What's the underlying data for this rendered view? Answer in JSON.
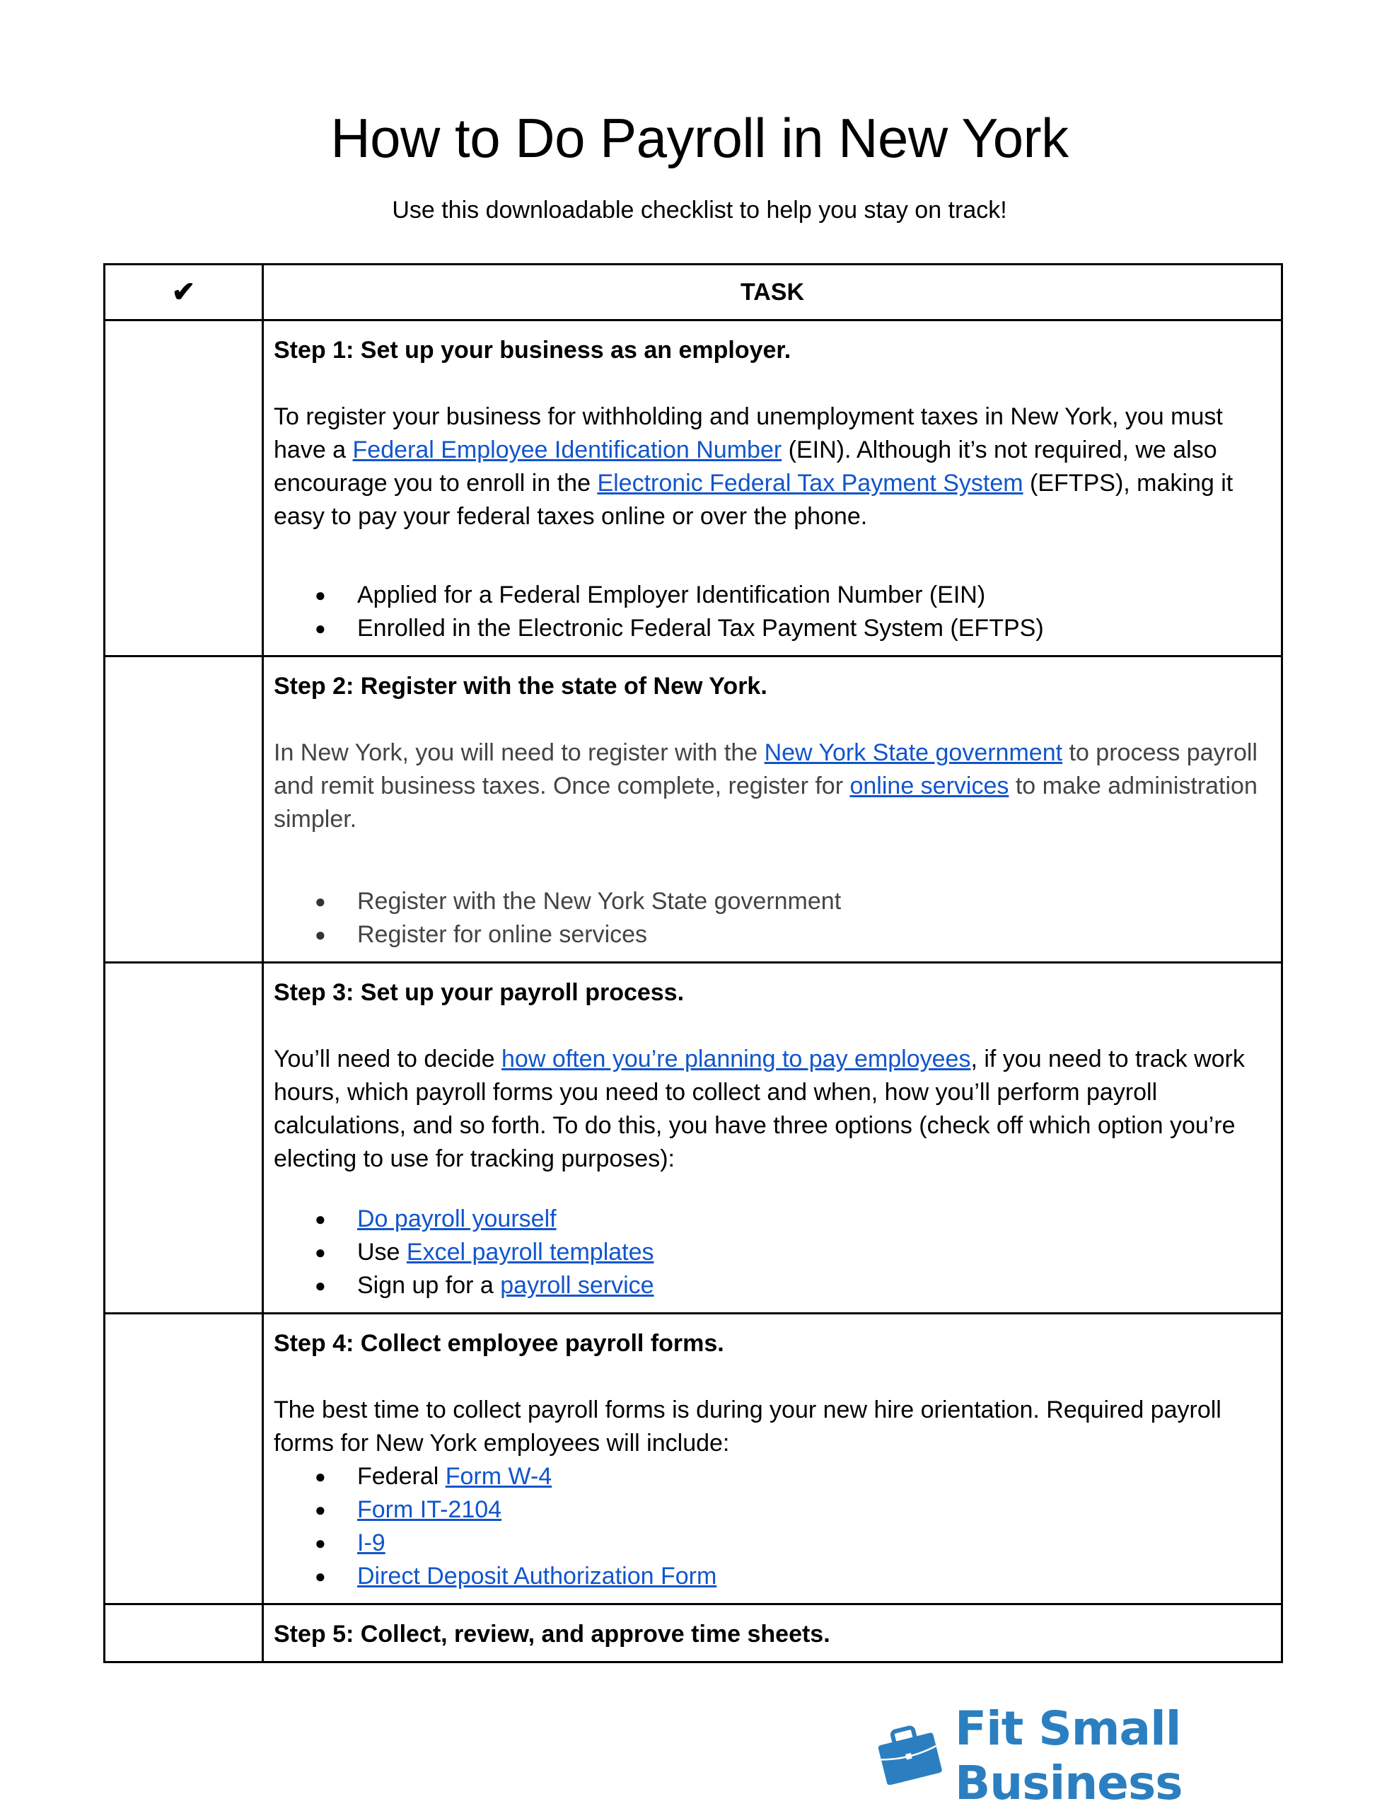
{
  "title": "How to Do Payroll in New York",
  "subtitle": "Use this downloadable checklist to help you stay on track!",
  "table": {
    "headers": {
      "check": "✔",
      "task": "TASK"
    },
    "steps": [
      {
        "title": "Step 1: Set up your business as an employer.",
        "para": {
          "t1": "To register your business for withholding and unemployment taxes in New York, you must have a ",
          "link1": "Federal Employee Identification Number",
          "t2": " (EIN). Although it’s not required, we also encourage you to enroll in the ",
          "link2": "Electronic Federal Tax Payment System",
          "t3": " (EFTPS), making it easy to pay your federal taxes online or over the phone."
        },
        "items": [
          "Applied for a Federal Employer Identification Number (EIN)",
          "Enrolled in the Electronic Federal Tax Payment System (EFTPS)"
        ]
      },
      {
        "title": "Step 2: Register with the state of New York.",
        "para": {
          "t1": "In New York, you will need to register with the ",
          "link1": "New York State government",
          "t2": " to process payroll and remit business taxes. Once complete, register for ",
          "link2": "online services",
          "t3": " to make administration simpler."
        },
        "items": [
          "Register with the New York State government",
          "Register for online services"
        ]
      },
      {
        "title": "Step 3: Set up your payroll process.",
        "para": {
          "t1": "You’ll need to decide ",
          "link1": "how often you’re planning to pay employees",
          "t2": ", if you need to track work hours, which payroll forms you need to collect and when, how you’ll perform payroll calculations, and so forth. To do this, you have three options (check off which option you’re electing to use for tracking purposes):"
        },
        "items": [
          {
            "prefix": "",
            "link": "Do payroll yourself"
          },
          {
            "prefix": "Use ",
            "link": "Excel payroll templates"
          },
          {
            "prefix": "Sign up for a ",
            "link": "payroll service"
          }
        ]
      },
      {
        "title": "Step 4: Collect employee payroll forms.",
        "para": {
          "t1": "The best time to collect payroll forms is during your new hire orientation. Required payroll forms for New York employees will include:"
        },
        "items": [
          {
            "prefix": "Federal ",
            "link": "Form W-4"
          },
          {
            "prefix": "",
            "link": "Form IT-2104"
          },
          {
            "prefix": "",
            "link": "I-9"
          },
          {
            "prefix": "",
            "link": "Direct Deposit Authorization Form"
          }
        ]
      },
      {
        "title": "Step 5: Collect, review, and approve time sheets."
      }
    ]
  },
  "logo": {
    "text": "Fit Small Business",
    "icon": "briefcase-icon",
    "color": "#2b7fc0"
  },
  "colors": {
    "link": "#1155cc",
    "text": "#000000",
    "muted_text": "#444444"
  }
}
